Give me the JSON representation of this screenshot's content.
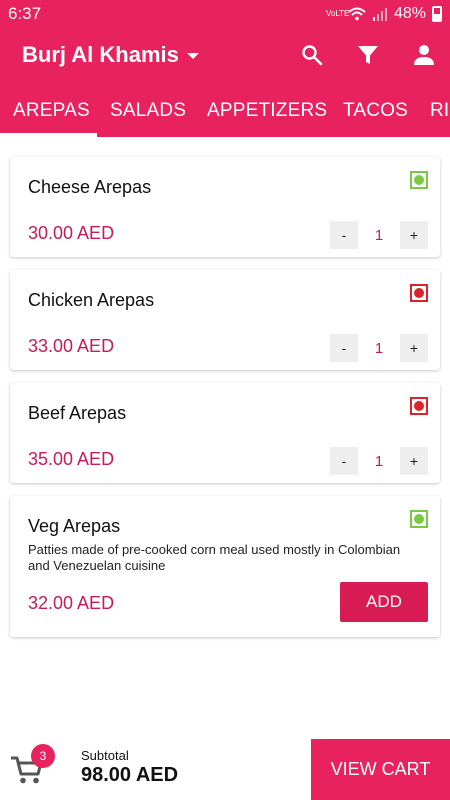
{
  "status_bar": {
    "time": "6:37",
    "network": "VoLTE",
    "battery": "48%"
  },
  "header": {
    "location": "Burj Al Khamis",
    "icons": [
      "search-icon",
      "filter-icon",
      "account-icon"
    ]
  },
  "tabs": [
    "AREPAS",
    "SALADS",
    "APPETIZERS",
    "TACOS",
    "RI"
  ],
  "active_tab": "AREPAS",
  "items": [
    {
      "name": "Cheese Arepas",
      "price": "30.00 AED",
      "veg": true,
      "qty": "1",
      "minus": "-",
      "plus": "+"
    },
    {
      "name": "Chicken Arepas",
      "price": "33.00 AED",
      "veg": false,
      "qty": "1",
      "minus": "-",
      "plus": "+"
    },
    {
      "name": "Beef Arepas",
      "price": "35.00 AED",
      "veg": false,
      "qty": "1",
      "minus": "-",
      "plus": "+"
    },
    {
      "name": "Veg Arepas",
      "description": "Patties made of pre-cooked corn meal used mostly in Colombian and Venezuelan cuisine",
      "price": "32.00 AED",
      "veg": true,
      "add_label": "ADD"
    }
  ],
  "cart": {
    "badge_count": "3",
    "subtotal_label": "Subtotal",
    "subtotal_value": "98.00 AED",
    "view_cart_label": "VIEW CART"
  },
  "colors": {
    "brand": "#e8225f",
    "price": "#c81a57",
    "veg": "#7ac943",
    "nonveg": "#d9252a"
  }
}
